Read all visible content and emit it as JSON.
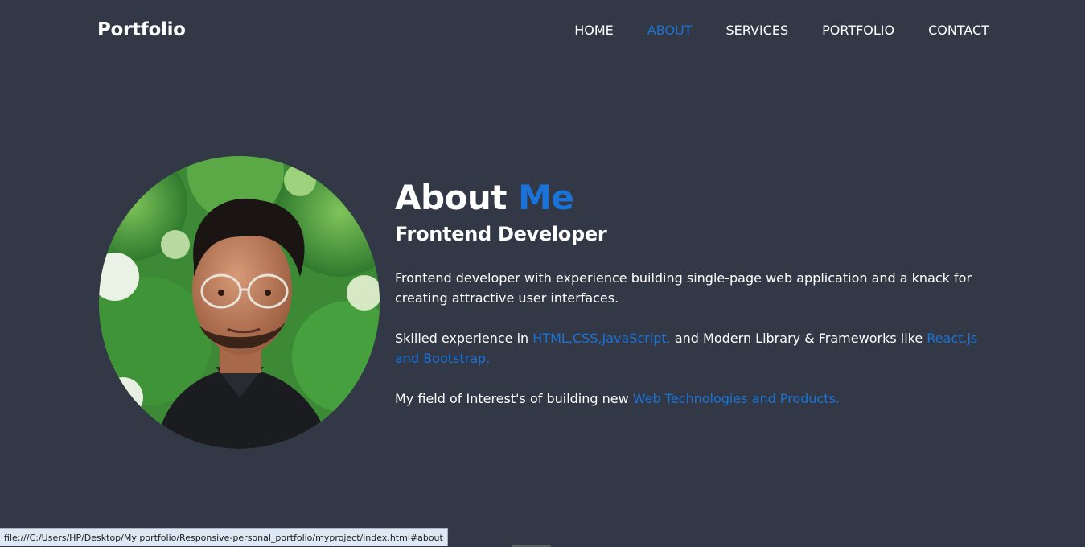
{
  "nav": {
    "brand": "Portfolio",
    "links": [
      {
        "label": "HOME",
        "active": false
      },
      {
        "label": "ABOUT",
        "active": true
      },
      {
        "label": "SERVICES",
        "active": false
      },
      {
        "label": "PORTFOLIO",
        "active": false
      },
      {
        "label": "CONTACT",
        "active": false
      }
    ]
  },
  "about": {
    "title_main": "About",
    "title_accent": "Me",
    "subtitle": "Frontend Developer",
    "paragraph1": "Frontend developer with experience building single-page web application and a knack for creating attractive user interfaces.",
    "paragraph2_prefix": "Skilled experience in",
    "paragraph2_highlight1": "HTML,CSS,JavaScript.",
    "paragraph2_middle": "and Modern Library & Frameworks like",
    "paragraph2_highlight2": "React.js and Bootstrap.",
    "paragraph3_prefix": "My field of Interest's of building new",
    "paragraph3_highlight": "Web Technologies and Products."
  },
  "status_bar": {
    "url": "file:///C:/Users/HP/Desktop/My portfolio/Responsive-personal_portfolio/myproject/index.html#about"
  },
  "colors": {
    "background": "#323846",
    "accent": "#1a73d9",
    "text": "#ffffff"
  }
}
